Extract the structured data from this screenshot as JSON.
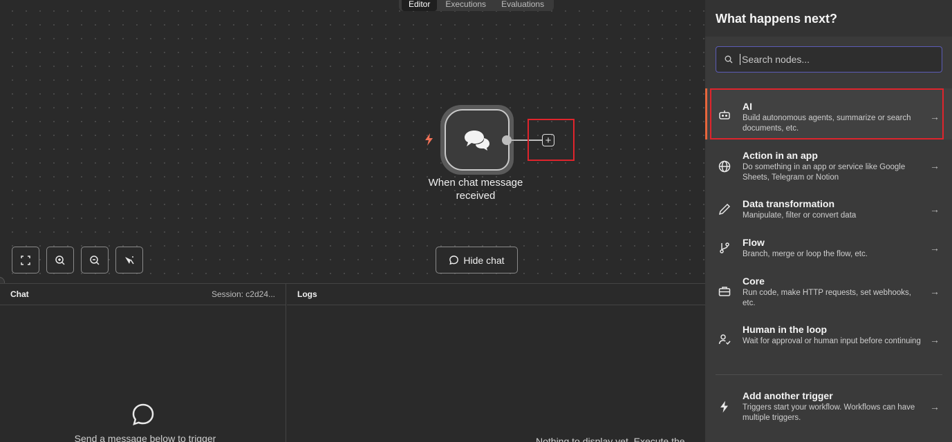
{
  "tabs": [
    {
      "label": "Editor",
      "active": true
    },
    {
      "label": "Executions",
      "active": false
    },
    {
      "label": "Evaluations",
      "active": false
    }
  ],
  "node": {
    "label_line1": "When chat message",
    "label_line2": "received",
    "icon": "chat-bubbles-icon"
  },
  "canvas_controls": [
    {
      "name": "zoom-to-fit-button",
      "icon": "fit-view-icon"
    },
    {
      "name": "zoom-in-button",
      "icon": "zoom-in-icon"
    },
    {
      "name": "zoom-out-button",
      "icon": "zoom-out-icon"
    },
    {
      "name": "tidy-up-button",
      "icon": "broom-icon"
    }
  ],
  "hide_chat_label": "Hide chat",
  "chat_panel": {
    "title": "Chat",
    "session": "Session: c2d24...",
    "empty_text": "Send a message below to trigger"
  },
  "logs_panel": {
    "title": "Logs",
    "empty_text": "Nothing to display yet. Execute the"
  },
  "side_panel": {
    "title": "What happens next?",
    "search_placeholder": "Search nodes...",
    "items": [
      {
        "title": "AI",
        "desc": "Build autonomous agents, summarize or search documents, etc.",
        "icon": "robot-icon"
      },
      {
        "title": "Action in an app",
        "desc": "Do something in an app or service like Google Sheets, Telegram or Notion",
        "icon": "globe-icon"
      },
      {
        "title": "Data transformation",
        "desc": "Manipulate, filter or convert data",
        "icon": "pen-icon"
      },
      {
        "title": "Flow",
        "desc": "Branch, merge or loop the flow, etc.",
        "icon": "branch-icon"
      },
      {
        "title": "Core",
        "desc": "Run code, make HTTP requests, set webhooks, etc.",
        "icon": "toolbox-icon"
      },
      {
        "title": "Human in the loop",
        "desc": "Wait for approval or human input before continuing",
        "icon": "user-check-icon"
      }
    ],
    "trigger_item": {
      "title": "Add another trigger",
      "desc": "Triggers start your workflow. Workflows can have multiple triggers.",
      "icon": "bolt-icon"
    }
  },
  "colors": {
    "highlight": "#e0242c",
    "accent": "#e8663c",
    "search_border": "#5c5cb8"
  }
}
